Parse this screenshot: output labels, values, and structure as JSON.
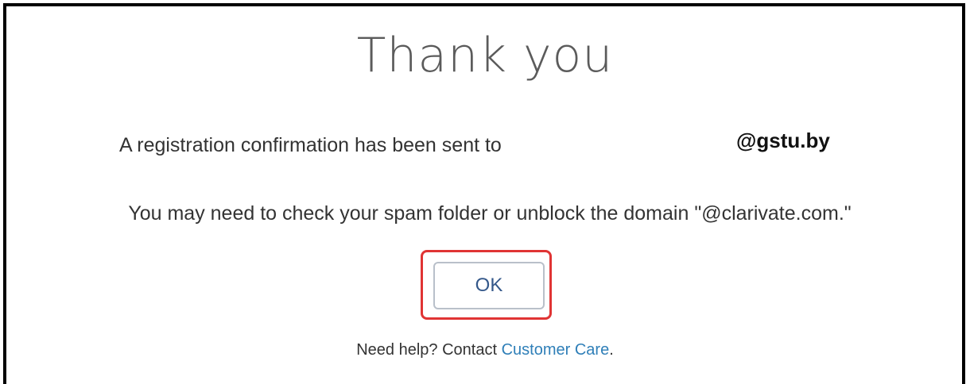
{
  "dialog": {
    "title": "Thank you",
    "confirmation_text": "A registration confirmation has been sent to",
    "email_domain": "@gstu.by",
    "spam_notice": "You may need to check your spam folder or unblock the domain \"@clarivate.com.\"",
    "ok_label": "OK",
    "help_prefix": "Need help? Contact",
    "help_link": "Customer Care",
    "help_suffix": "."
  },
  "colors": {
    "highlight": "#e03434",
    "link": "#2f7fb8",
    "button_text": "#34588a"
  }
}
